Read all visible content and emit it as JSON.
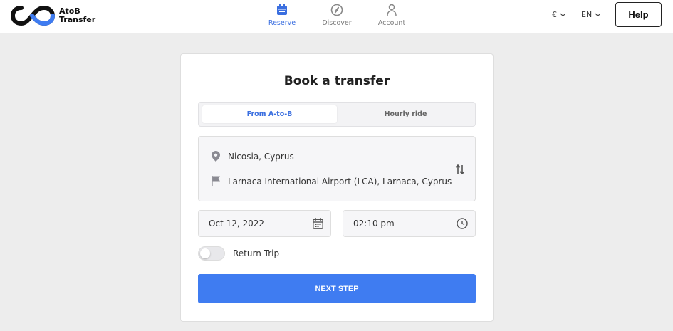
{
  "header": {
    "brand_line1": "AtoB",
    "brand_line2": "Transfer",
    "nav": [
      {
        "label": "Reserve",
        "icon": "calendar-icon",
        "active": true
      },
      {
        "label": "Discover",
        "icon": "compass-icon",
        "active": false
      },
      {
        "label": "Account",
        "icon": "user-icon",
        "active": false
      }
    ],
    "currency": "€",
    "language": "EN",
    "help_label": "Help"
  },
  "booking": {
    "title": "Book a transfer",
    "tabs": [
      {
        "label": "From A-to-B",
        "active": true
      },
      {
        "label": "Hourly ride",
        "active": false
      }
    ],
    "from": "Nicosia, Cyprus",
    "to": "Larnaca International Airport (LCA), Larnaca, Cyprus",
    "date": "Oct 12, 2022",
    "time": "02:10 pm",
    "return_trip_label": "Return Trip",
    "return_trip_enabled": false,
    "next_label": "NEXT STEP"
  },
  "colors": {
    "accent": "#3b6fe0",
    "button": "#3f7cf1",
    "background": "#ededed"
  }
}
